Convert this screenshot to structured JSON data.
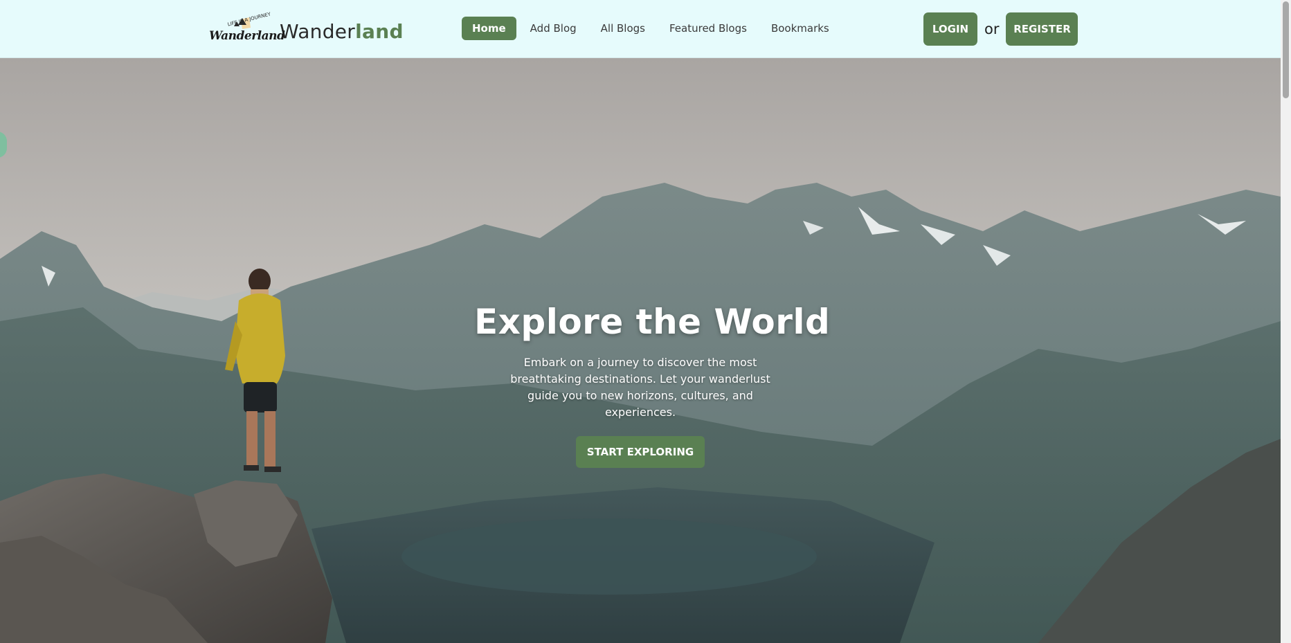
{
  "header": {
    "logo": {
      "script_text": "Wanderland",
      "tagline": "LIFE IS A JOURNEY"
    },
    "brand": {
      "prefix": "Wander",
      "accent": "land"
    },
    "nav": [
      {
        "label": "Home",
        "active": true
      },
      {
        "label": "Add Blog",
        "active": false
      },
      {
        "label": "All Blogs",
        "active": false
      },
      {
        "label": "Featured Blogs",
        "active": false
      },
      {
        "label": "Bookmarks",
        "active": false
      }
    ],
    "auth": {
      "login_label": "LOGIN",
      "or_label": "or",
      "register_label": "REGISTER"
    }
  },
  "hero": {
    "title": "Explore the World",
    "subtitle": "Embark on a journey to discover the most breathtaking destinations. Let your wanderlust guide you to new horizons, cultures, and experiences.",
    "cta_label": "START EXPLORING"
  },
  "colors": {
    "accent": "#5a8052",
    "header_bg": "#e6fbfc"
  },
  "icons": {
    "side_tab": "side-tab-icon"
  }
}
